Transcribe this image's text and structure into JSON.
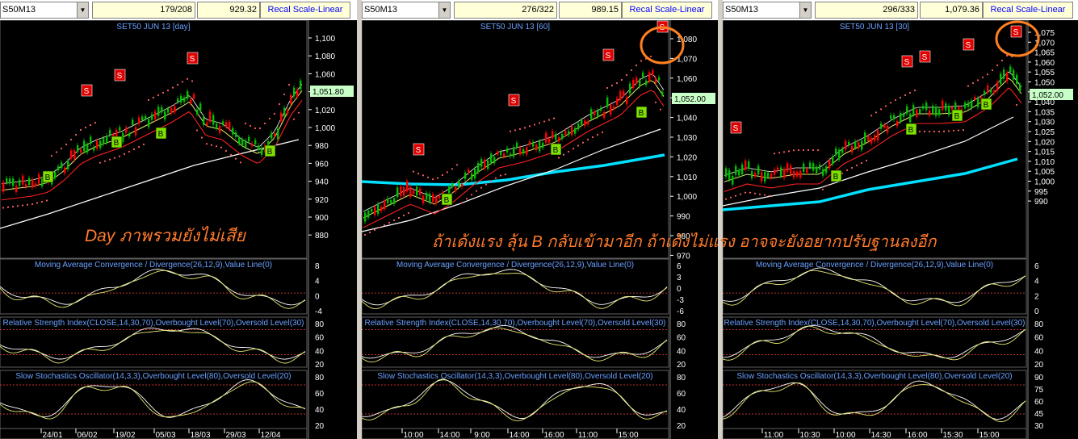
{
  "panels": [
    {
      "symbol": "S50M13",
      "count": "179/208",
      "price": "929.32",
      "recal": "Recal Scale-Linear",
      "title": "SET50 JUN 13  [day]",
      "last_price": "1,051.80",
      "yticks": [
        "1,100",
        "1,080",
        "1,060",
        "1,040",
        "1,020",
        "1,000",
        "980",
        "960",
        "940",
        "920",
        "900",
        "880"
      ],
      "xticks": [
        "24/01",
        "06/02",
        "19/02",
        "05/03",
        "18/03",
        "29/03",
        "12/04"
      ],
      "macd_ticks": [
        "8",
        "4",
        "0",
        "-4"
      ],
      "rsi_ticks": [
        "80",
        "60",
        "40",
        "20"
      ],
      "stoch_ticks": [
        "80",
        "60",
        "40",
        "20"
      ],
      "signals": [
        {
          "type": "S",
          "x": 107,
          "y": 112
        },
        {
          "type": "S",
          "x": 148,
          "y": 93
        },
        {
          "type": "S",
          "x": 238,
          "y": 72
        },
        {
          "type": "B",
          "x": 59,
          "y": 219
        },
        {
          "type": "B",
          "x": 144,
          "y": 176
        },
        {
          "type": "B",
          "x": 199,
          "y": 165
        },
        {
          "type": "B",
          "x": 334,
          "y": 187
        }
      ]
    },
    {
      "symbol": "S50M13",
      "count": "276/322",
      "price": "989.15",
      "recal": "Recal Scale-Linear",
      "title": "SET50 JUN 13  [60]",
      "last_price": "1,052.00",
      "yticks": [
        "1,080",
        "1,070",
        "1,060",
        "1,050",
        "1,040",
        "1,030",
        "1,020",
        "1,010",
        "1,000",
        "990",
        "980",
        "970"
      ],
      "xticks": [
        "10:00",
        "14:00",
        "9:00",
        "14:00",
        "16:00",
        "11:00",
        "15:00"
      ],
      "macd_ticks": [
        "6",
        "3",
        "0",
        "-3",
        "-6"
      ],
      "rsi_ticks": [
        "80",
        "60",
        "40",
        "20"
      ],
      "stoch_ticks": [
        "80",
        "60",
        "40",
        "20"
      ],
      "signals": [
        {
          "type": "S",
          "x": 518,
          "y": 185
        },
        {
          "type": "S",
          "x": 636,
          "y": 124
        },
        {
          "type": "S",
          "x": 753,
          "y": 68
        },
        {
          "type": "S",
          "x": 820,
          "y": 33
        },
        {
          "type": "B",
          "x": 553,
          "y": 247
        },
        {
          "type": "B",
          "x": 688,
          "y": 185
        },
        {
          "type": "B",
          "x": 794,
          "y": 139
        }
      ]
    },
    {
      "symbol": "S50M13",
      "count": "296/333",
      "price": "1,079.36",
      "recal": "Recal Scale-Linear",
      "title": "SET50 JUN 13  [30]",
      "last_price": "1,052.00",
      "yticks": [
        "1,075",
        "1,070",
        "1,065",
        "1,060",
        "1,055",
        "1,050",
        "1,045",
        "1,040",
        "1,035",
        "1,030",
        "1,025",
        "1,020",
        "1,015",
        "1,010",
        "1,005",
        "1,000",
        "995",
        "990"
      ],
      "xticks": [
        "11:00",
        "10:30",
        "10:00",
        "14:30",
        "16:00",
        "15:30",
        "15:00"
      ],
      "macd_ticks": [
        "6",
        "4",
        "2",
        "0"
      ],
      "rsi_ticks": [
        "80",
        "60",
        "40",
        "20"
      ],
      "stoch_ticks": [
        "90",
        "75",
        "60",
        "45",
        "30"
      ],
      "signals": [
        {
          "type": "S",
          "x": 911,
          "y": 158
        },
        {
          "type": "S",
          "x": 1123,
          "y": 76
        },
        {
          "type": "S",
          "x": 1145,
          "y": 70
        },
        {
          "type": "S",
          "x": 1199,
          "y": 55
        },
        {
          "type": "S",
          "x": 1258,
          "y": 39
        },
        {
          "type": "B",
          "x": 1035,
          "y": 218
        },
        {
          "type": "B",
          "x": 1128,
          "y": 160
        },
        {
          "type": "B",
          "x": 1185,
          "y": 143
        },
        {
          "type": "B",
          "x": 1221,
          "y": 129
        }
      ]
    }
  ],
  "indicators": {
    "macd": "Moving Average Convergence / Divergence(26,12,9),Value Line(0)",
    "rsi": "Relative Strength Index(CLOSE,14,30,70),Overbought Level(70),Oversold Level(30)",
    "stoch": "Slow Stochastics Oscillator(14,3,3),Overbought Level(80),Oversold Level(20)"
  },
  "annotations": {
    "day": "Day ภาพรวมยังไม่เสีย",
    "intraday": "ถ้าเด้งแรง ลุ้น B กลับเข้ามาอีก ถ้าเด้งไม่แรง อาจจะยังอยากปรับฐานลงอีก"
  },
  "colors": {
    "price_up": "#00c000",
    "price_down": "#ff0000",
    "ema_fast": "#ffffff",
    "ema_mid": "#e8e870",
    "ema_slow": "#ff2020",
    "sar": "#ff6060",
    "long_ma": "#00e0ff",
    "signal_s": "#e00000",
    "signal_b": "#80e000",
    "circle": "#ff8020"
  }
}
